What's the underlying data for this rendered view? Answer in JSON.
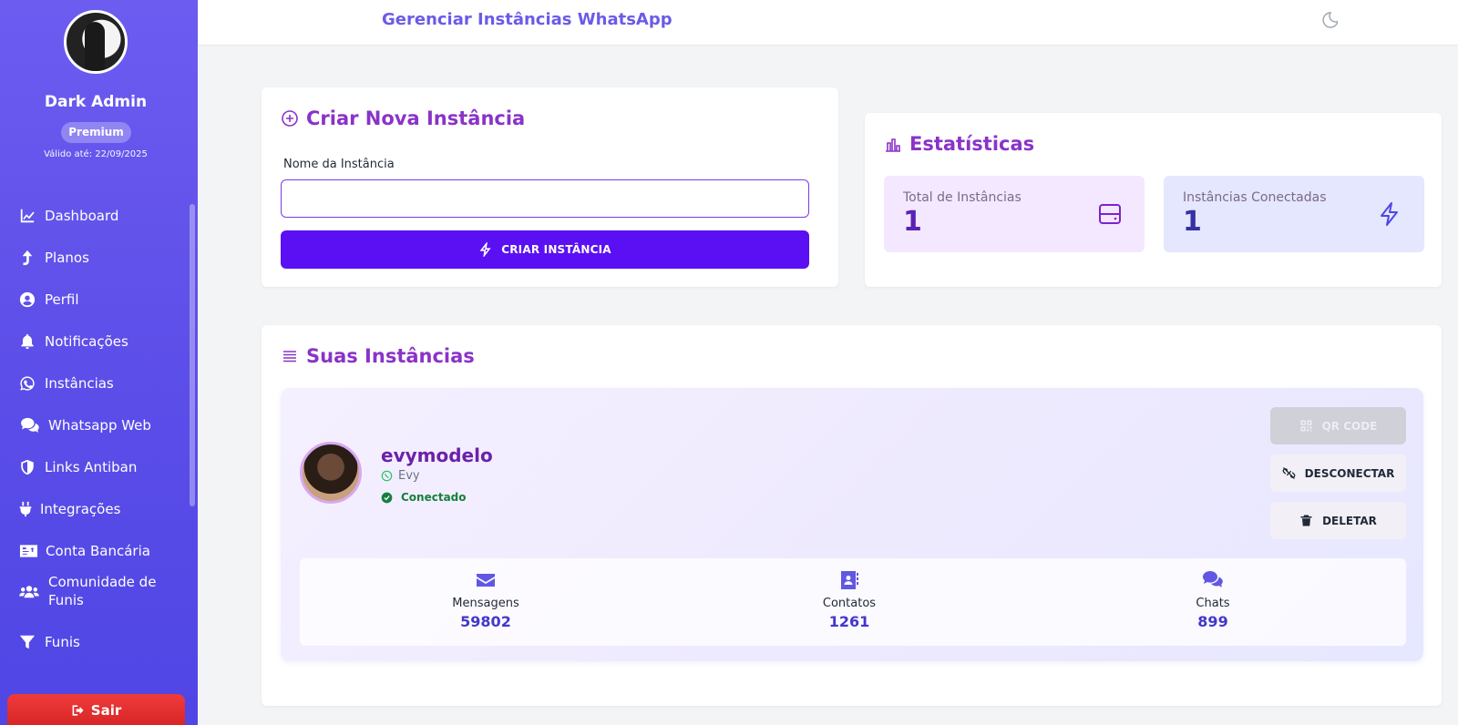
{
  "sidebar": {
    "user_name": "Dark Admin",
    "plan_badge": "Premium",
    "valid_until": "Válido até: 22/09/2025",
    "items": [
      {
        "label": "Dashboard",
        "icon": "chart-line-icon"
      },
      {
        "label": "Planos",
        "icon": "arrow-up-icon"
      },
      {
        "label": "Perfil",
        "icon": "user-circle-icon"
      },
      {
        "label": "Notificações",
        "icon": "bell-icon"
      },
      {
        "label": "Instâncias",
        "icon": "whatsapp-icon"
      },
      {
        "label": "Whatsapp Web",
        "icon": "comments-icon"
      },
      {
        "label": "Links Antiban",
        "icon": "shield-icon"
      },
      {
        "label": "Integrações",
        "icon": "plug-icon"
      },
      {
        "label": "Conta Bancária",
        "icon": "money-card-icon"
      },
      {
        "label": "Comunidade de Funis",
        "icon": "users-icon"
      },
      {
        "label": "Funis",
        "icon": "funnel-icon"
      }
    ],
    "logout_label": "Sair"
  },
  "header": {
    "title": "Gerenciar Instâncias WhatsApp",
    "theme_icon": "moon-icon"
  },
  "create_card": {
    "title": "Criar Nova Instância",
    "field_label": "Nome da Instância",
    "field_value": "",
    "field_placeholder": "",
    "button_label": "CRIAR INSTÂNCIA"
  },
  "stats_card": {
    "title": "Estatísticas",
    "total_label": "Total de Instâncias",
    "total_value": "1",
    "connected_label": "Instâncias Conectadas",
    "connected_value": "1"
  },
  "instances_card": {
    "title": "Suas Instâncias",
    "instances": [
      {
        "name": "evymodelo",
        "profile_name": "Evy",
        "status": "Conectado",
        "buttons": {
          "qr": "QR CODE",
          "disconnect": "DESCONECTAR",
          "delete": "DELETAR"
        },
        "metrics": [
          {
            "label": "Mensagens",
            "value": "59802",
            "icon": "envelope-icon"
          },
          {
            "label": "Contatos",
            "value": "1261",
            "icon": "address-book-icon"
          },
          {
            "label": "Chats",
            "value": "899",
            "icon": "comments-icon"
          }
        ]
      }
    ]
  },
  "colors": {
    "sidebar": "#5b4de8",
    "accent": "#5a10f2",
    "title": "#8a33c8",
    "logout": "#e02424",
    "connected": "#15803d"
  }
}
